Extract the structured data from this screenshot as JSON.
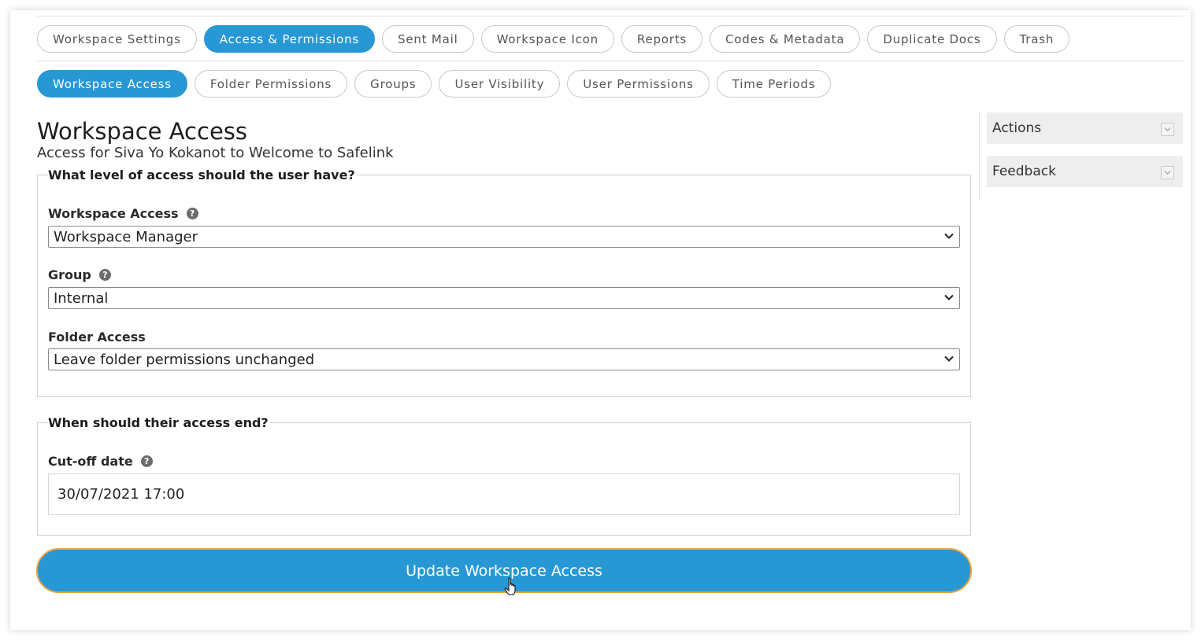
{
  "top_tabs": [
    {
      "label": "Workspace Settings",
      "active": false
    },
    {
      "label": "Access & Permissions",
      "active": true
    },
    {
      "label": "Sent Mail",
      "active": false
    },
    {
      "label": "Workspace Icon",
      "active": false
    },
    {
      "label": "Reports",
      "active": false
    },
    {
      "label": "Codes & Metadata",
      "active": false
    },
    {
      "label": "Duplicate Docs",
      "active": false
    },
    {
      "label": "Trash",
      "active": false
    }
  ],
  "sub_tabs": [
    {
      "label": "Workspace Access",
      "active": true
    },
    {
      "label": "Folder Permissions",
      "active": false
    },
    {
      "label": "Groups",
      "active": false
    },
    {
      "label": "User Visibility",
      "active": false
    },
    {
      "label": "User Permissions",
      "active": false
    },
    {
      "label": "Time Periods",
      "active": false
    }
  ],
  "page": {
    "title": "Workspace Access",
    "subtitle": "Access for Siva Yo Kokanot to Welcome to Safelink"
  },
  "access_section": {
    "legend": "What level of access should the user have?",
    "workspace_access": {
      "label": "Workspace Access",
      "value": "Workspace Manager"
    },
    "group": {
      "label": "Group",
      "value": "Internal"
    },
    "folder_access": {
      "label": "Folder Access",
      "value": "Leave folder permissions unchanged"
    }
  },
  "end_section": {
    "legend": "When should their access end?",
    "cutoff": {
      "label": "Cut-off date",
      "value": "30/07/2021 17:00"
    }
  },
  "submit_label": "Update Workspace Access",
  "sidebar": {
    "actions_label": "Actions",
    "feedback_label": "Feedback"
  },
  "help_glyph": "?",
  "colors": {
    "accent": "#2898d5",
    "focus_ring": "#e8a23c"
  }
}
